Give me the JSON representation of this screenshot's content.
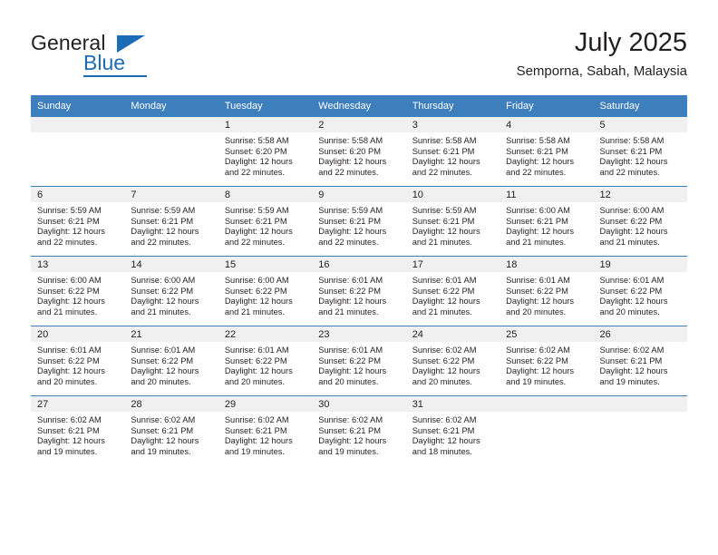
{
  "brand": {
    "name_top": "General",
    "name_bottom": "Blue",
    "accent_color": "#1b6cb5"
  },
  "header": {
    "title": "July 2025",
    "subtitle": "Semporna, Sabah, Malaysia"
  },
  "calendar": {
    "header_bg": "#3d7ebd",
    "daynum_bg": "#f0f0f0",
    "weekday_headers": [
      "Sunday",
      "Monday",
      "Tuesday",
      "Wednesday",
      "Thursday",
      "Friday",
      "Saturday"
    ],
    "weeks": [
      [
        {
          "day": "",
          "sunrise": "",
          "sunset": "",
          "daylight1": "",
          "daylight2": ""
        },
        {
          "day": "",
          "sunrise": "",
          "sunset": "",
          "daylight1": "",
          "daylight2": ""
        },
        {
          "day": "1",
          "sunrise": "Sunrise: 5:58 AM",
          "sunset": "Sunset: 6:20 PM",
          "daylight1": "Daylight: 12 hours",
          "daylight2": "and 22 minutes."
        },
        {
          "day": "2",
          "sunrise": "Sunrise: 5:58 AM",
          "sunset": "Sunset: 6:20 PM",
          "daylight1": "Daylight: 12 hours",
          "daylight2": "and 22 minutes."
        },
        {
          "day": "3",
          "sunrise": "Sunrise: 5:58 AM",
          "sunset": "Sunset: 6:21 PM",
          "daylight1": "Daylight: 12 hours",
          "daylight2": "and 22 minutes."
        },
        {
          "day": "4",
          "sunrise": "Sunrise: 5:58 AM",
          "sunset": "Sunset: 6:21 PM",
          "daylight1": "Daylight: 12 hours",
          "daylight2": "and 22 minutes."
        },
        {
          "day": "5",
          "sunrise": "Sunrise: 5:58 AM",
          "sunset": "Sunset: 6:21 PM",
          "daylight1": "Daylight: 12 hours",
          "daylight2": "and 22 minutes."
        }
      ],
      [
        {
          "day": "6",
          "sunrise": "Sunrise: 5:59 AM",
          "sunset": "Sunset: 6:21 PM",
          "daylight1": "Daylight: 12 hours",
          "daylight2": "and 22 minutes."
        },
        {
          "day": "7",
          "sunrise": "Sunrise: 5:59 AM",
          "sunset": "Sunset: 6:21 PM",
          "daylight1": "Daylight: 12 hours",
          "daylight2": "and 22 minutes."
        },
        {
          "day": "8",
          "sunrise": "Sunrise: 5:59 AM",
          "sunset": "Sunset: 6:21 PM",
          "daylight1": "Daylight: 12 hours",
          "daylight2": "and 22 minutes."
        },
        {
          "day": "9",
          "sunrise": "Sunrise: 5:59 AM",
          "sunset": "Sunset: 6:21 PM",
          "daylight1": "Daylight: 12 hours",
          "daylight2": "and 22 minutes."
        },
        {
          "day": "10",
          "sunrise": "Sunrise: 5:59 AM",
          "sunset": "Sunset: 6:21 PM",
          "daylight1": "Daylight: 12 hours",
          "daylight2": "and 21 minutes."
        },
        {
          "day": "11",
          "sunrise": "Sunrise: 6:00 AM",
          "sunset": "Sunset: 6:21 PM",
          "daylight1": "Daylight: 12 hours",
          "daylight2": "and 21 minutes."
        },
        {
          "day": "12",
          "sunrise": "Sunrise: 6:00 AM",
          "sunset": "Sunset: 6:22 PM",
          "daylight1": "Daylight: 12 hours",
          "daylight2": "and 21 minutes."
        }
      ],
      [
        {
          "day": "13",
          "sunrise": "Sunrise: 6:00 AM",
          "sunset": "Sunset: 6:22 PM",
          "daylight1": "Daylight: 12 hours",
          "daylight2": "and 21 minutes."
        },
        {
          "day": "14",
          "sunrise": "Sunrise: 6:00 AM",
          "sunset": "Sunset: 6:22 PM",
          "daylight1": "Daylight: 12 hours",
          "daylight2": "and 21 minutes."
        },
        {
          "day": "15",
          "sunrise": "Sunrise: 6:00 AM",
          "sunset": "Sunset: 6:22 PM",
          "daylight1": "Daylight: 12 hours",
          "daylight2": "and 21 minutes."
        },
        {
          "day": "16",
          "sunrise": "Sunrise: 6:01 AM",
          "sunset": "Sunset: 6:22 PM",
          "daylight1": "Daylight: 12 hours",
          "daylight2": "and 21 minutes."
        },
        {
          "day": "17",
          "sunrise": "Sunrise: 6:01 AM",
          "sunset": "Sunset: 6:22 PM",
          "daylight1": "Daylight: 12 hours",
          "daylight2": "and 21 minutes."
        },
        {
          "day": "18",
          "sunrise": "Sunrise: 6:01 AM",
          "sunset": "Sunset: 6:22 PM",
          "daylight1": "Daylight: 12 hours",
          "daylight2": "and 20 minutes."
        },
        {
          "day": "19",
          "sunrise": "Sunrise: 6:01 AM",
          "sunset": "Sunset: 6:22 PM",
          "daylight1": "Daylight: 12 hours",
          "daylight2": "and 20 minutes."
        }
      ],
      [
        {
          "day": "20",
          "sunrise": "Sunrise: 6:01 AM",
          "sunset": "Sunset: 6:22 PM",
          "daylight1": "Daylight: 12 hours",
          "daylight2": "and 20 minutes."
        },
        {
          "day": "21",
          "sunrise": "Sunrise: 6:01 AM",
          "sunset": "Sunset: 6:22 PM",
          "daylight1": "Daylight: 12 hours",
          "daylight2": "and 20 minutes."
        },
        {
          "day": "22",
          "sunrise": "Sunrise: 6:01 AM",
          "sunset": "Sunset: 6:22 PM",
          "daylight1": "Daylight: 12 hours",
          "daylight2": "and 20 minutes."
        },
        {
          "day": "23",
          "sunrise": "Sunrise: 6:01 AM",
          "sunset": "Sunset: 6:22 PM",
          "daylight1": "Daylight: 12 hours",
          "daylight2": "and 20 minutes."
        },
        {
          "day": "24",
          "sunrise": "Sunrise: 6:02 AM",
          "sunset": "Sunset: 6:22 PM",
          "daylight1": "Daylight: 12 hours",
          "daylight2": "and 20 minutes."
        },
        {
          "day": "25",
          "sunrise": "Sunrise: 6:02 AM",
          "sunset": "Sunset: 6:22 PM",
          "daylight1": "Daylight: 12 hours",
          "daylight2": "and 19 minutes."
        },
        {
          "day": "26",
          "sunrise": "Sunrise: 6:02 AM",
          "sunset": "Sunset: 6:21 PM",
          "daylight1": "Daylight: 12 hours",
          "daylight2": "and 19 minutes."
        }
      ],
      [
        {
          "day": "27",
          "sunrise": "Sunrise: 6:02 AM",
          "sunset": "Sunset: 6:21 PM",
          "daylight1": "Daylight: 12 hours",
          "daylight2": "and 19 minutes."
        },
        {
          "day": "28",
          "sunrise": "Sunrise: 6:02 AM",
          "sunset": "Sunset: 6:21 PM",
          "daylight1": "Daylight: 12 hours",
          "daylight2": "and 19 minutes."
        },
        {
          "day": "29",
          "sunrise": "Sunrise: 6:02 AM",
          "sunset": "Sunset: 6:21 PM",
          "daylight1": "Daylight: 12 hours",
          "daylight2": "and 19 minutes."
        },
        {
          "day": "30",
          "sunrise": "Sunrise: 6:02 AM",
          "sunset": "Sunset: 6:21 PM",
          "daylight1": "Daylight: 12 hours",
          "daylight2": "and 19 minutes."
        },
        {
          "day": "31",
          "sunrise": "Sunrise: 6:02 AM",
          "sunset": "Sunset: 6:21 PM",
          "daylight1": "Daylight: 12 hours",
          "daylight2": "and 18 minutes."
        },
        {
          "day": "",
          "sunrise": "",
          "sunset": "",
          "daylight1": "",
          "daylight2": ""
        },
        {
          "day": "",
          "sunrise": "",
          "sunset": "",
          "daylight1": "",
          "daylight2": ""
        }
      ]
    ]
  }
}
